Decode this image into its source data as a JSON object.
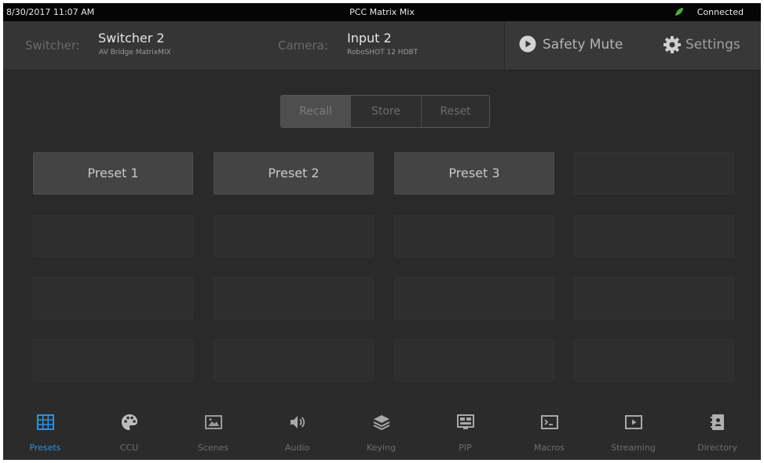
{
  "status_bar": {
    "datetime": "8/30/2017 11:07 AM",
    "title": "PCC Matrix Mix",
    "connection": "Connected",
    "connection_color": "#4caf3a"
  },
  "header": {
    "switcher_label": "Switcher:",
    "switcher_name": "Switcher 2",
    "switcher_model": "AV Bridge MatrixMIX",
    "camera_label": "Camera:",
    "camera_name": "Input 2",
    "camera_model": "RoboSHOT 12 HDBT",
    "safety_mute_label": "Safety Mute",
    "settings_label": "Settings"
  },
  "mode_tabs": [
    {
      "label": "Recall",
      "active": true
    },
    {
      "label": "Store",
      "active": false
    },
    {
      "label": "Reset",
      "active": false
    }
  ],
  "presets": [
    {
      "label": "Preset 1",
      "enabled": true
    },
    {
      "label": "Preset 2",
      "enabled": true
    },
    {
      "label": "Preset 3",
      "enabled": true
    },
    {
      "label": "",
      "enabled": false
    },
    {
      "label": "",
      "enabled": false
    },
    {
      "label": "",
      "enabled": false
    },
    {
      "label": "",
      "enabled": false
    },
    {
      "label": "",
      "enabled": false
    },
    {
      "label": "",
      "enabled": false
    },
    {
      "label": "",
      "enabled": false
    },
    {
      "label": "",
      "enabled": false
    },
    {
      "label": "",
      "enabled": false
    },
    {
      "label": "",
      "enabled": false
    },
    {
      "label": "",
      "enabled": false
    },
    {
      "label": "",
      "enabled": false
    },
    {
      "label": "",
      "enabled": false
    }
  ],
  "nav": [
    {
      "label": "Presets",
      "icon": "grid-icon",
      "active": true
    },
    {
      "label": "CCU",
      "icon": "palette-icon",
      "active": false
    },
    {
      "label": "Scenes",
      "icon": "scene-image-icon",
      "active": false
    },
    {
      "label": "Audio",
      "icon": "speaker-icon",
      "active": false
    },
    {
      "label": "Keying",
      "icon": "layers-icon",
      "active": false
    },
    {
      "label": "PIP",
      "icon": "pip-monitor-icon",
      "active": false
    },
    {
      "label": "Macros",
      "icon": "terminal-icon",
      "active": false
    },
    {
      "label": "Streaming",
      "icon": "play-box-icon",
      "active": false
    },
    {
      "label": "Directory",
      "icon": "address-book-icon",
      "active": false
    }
  ],
  "colors": {
    "accent": "#2f8fe0",
    "background": "#2a2a2a",
    "status_bar": "#050505"
  }
}
